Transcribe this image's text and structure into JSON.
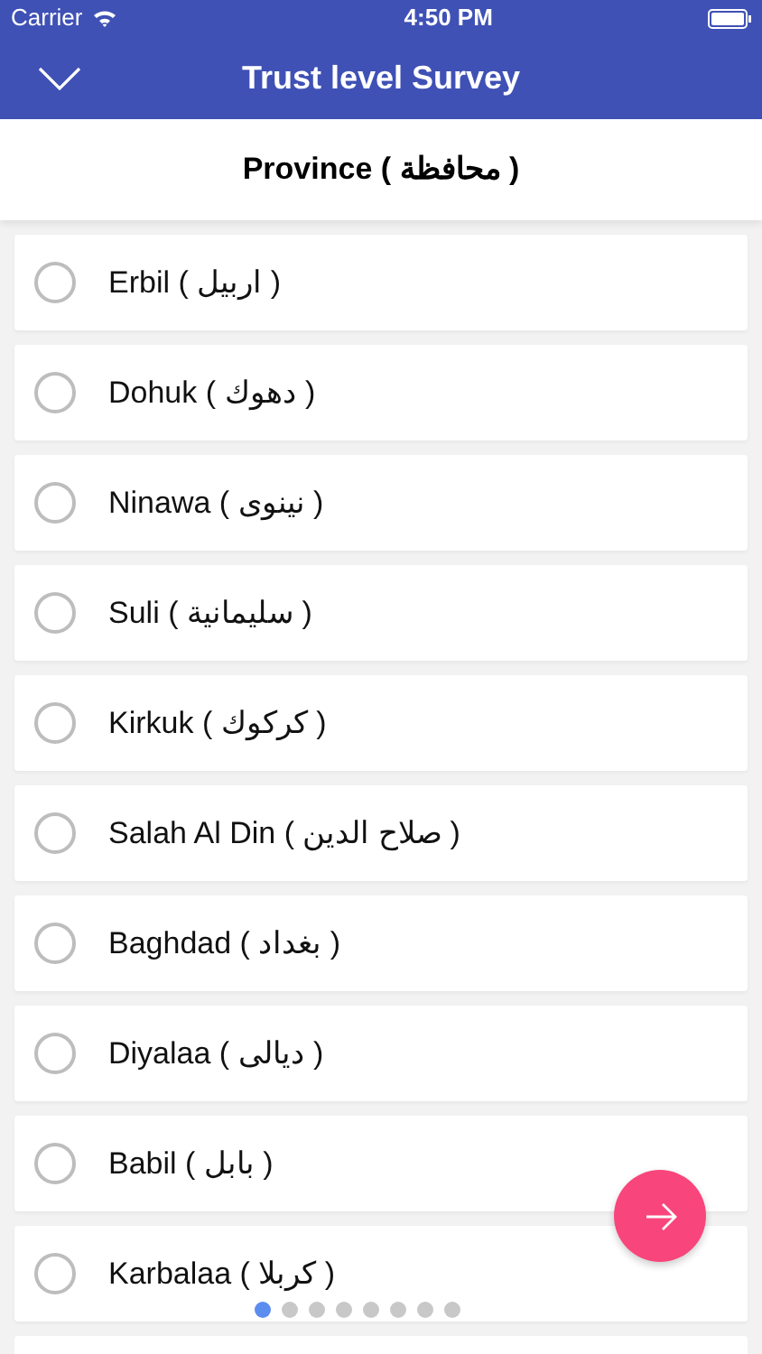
{
  "status_bar": {
    "carrier": "Carrier",
    "time": "4:50 PM"
  },
  "header": {
    "title": "Trust level Survey"
  },
  "question": {
    "title": "Province ( محافظة )"
  },
  "options": [
    {
      "label": "Erbil ( اربيل )",
      "selected": false
    },
    {
      "label": "Dohuk ( دهوك )",
      "selected": false
    },
    {
      "label": "Ninawa ( نينوى )",
      "selected": false
    },
    {
      "label": "Suli ( سليمانية )",
      "selected": false
    },
    {
      "label": "Kirkuk ( كركوك )",
      "selected": false
    },
    {
      "label": "Salah Al Din ( صلاح الدين )",
      "selected": false
    },
    {
      "label": "Baghdad ( بغداد )",
      "selected": false
    },
    {
      "label": "Diyalaa ( ديالى )",
      "selected": false
    },
    {
      "label": "Babil ( بابل )",
      "selected": false
    },
    {
      "label": "Karbalaa ( كربلا )",
      "selected": false
    }
  ],
  "page_dots": [
    {
      "selected": true
    },
    {
      "selected": false
    },
    {
      "selected": false
    },
    {
      "selected": false
    },
    {
      "selected": false
    },
    {
      "selected": false
    },
    {
      "selected": false
    },
    {
      "selected": false
    }
  ]
}
